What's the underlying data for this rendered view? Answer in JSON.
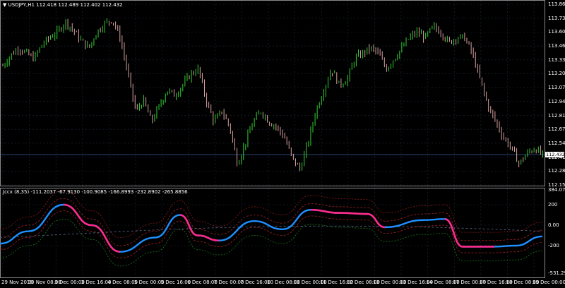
{
  "chart": {
    "symbol_label": "USDJPY,H1",
    "ohlc_text": "112.418 112.489 112.402 112.432",
    "current_price": "112.432",
    "price_ticks": [
      "113.865",
      "113.730",
      "113.600",
      "113.465",
      "113.335",
      "113.205",
      "113.070",
      "112.940",
      "112.810",
      "112.675",
      "112.545",
      "112.410",
      "112.280",
      "112.150"
    ],
    "colors": {
      "bull": "#32cd32",
      "bear": "#d8a0a0",
      "grid": "#1e2a3a",
      "line": "#1e90ff",
      "line_hot": "#ff2a8a"
    }
  },
  "indicator": {
    "label": "Jccx (8,35) -111.2037 -67.9130 -100.9085 -166.8993 -232.8902 -265.8856",
    "ticks": [
      "384.078",
      "200",
      "0.00",
      "-200",
      "-531.2956"
    ]
  },
  "time_axis": [
    "29 Nov 2018",
    "30 Nov 08:00",
    "3 Dec 00:00",
    "3 Dec 16:00",
    "4 Dec 08:00",
    "5 Dec 00:00",
    "5 Dec 16:00",
    "6 Dec 08:00",
    "7 Dec 00:00",
    "7 Dec 16:00",
    "10 Dec 08:00",
    "11 Dec 00:00",
    "11 Dec 16:00",
    "12 Dec 08:00",
    "13 Dec 00:00",
    "13 Dec 16:00",
    "14 Dec 08:00",
    "17 Dec 00:00",
    "17 Dec 16:00",
    "18 Dec 08:00",
    "19 Dec 00:00"
  ],
  "chart_data": {
    "type": "candlestick",
    "title": "USDJPY,H1",
    "ylim": [
      112.15,
      113.865
    ],
    "close_path": [
      113.28,
      113.38,
      113.45,
      113.4,
      113.35,
      113.48,
      113.55,
      113.6,
      113.7,
      113.62,
      113.52,
      113.45,
      113.6,
      113.68,
      113.72,
      113.55,
      113.2,
      112.85,
      112.95,
      112.75,
      112.9,
      113.05,
      113.0,
      113.1,
      113.2,
      113.25,
      112.95,
      112.75,
      112.85,
      112.7,
      112.35,
      112.55,
      112.75,
      112.85,
      112.75,
      112.7,
      112.6,
      112.4,
      112.3,
      112.55,
      112.85,
      113.05,
      113.25,
      113.1,
      113.15,
      113.35,
      113.4,
      113.45,
      113.4,
      113.25,
      113.35,
      113.45,
      113.55,
      113.6,
      113.55,
      113.65,
      113.6,
      113.5,
      113.55,
      113.55,
      113.4,
      113.15,
      112.9,
      112.75,
      112.6,
      112.5,
      112.35,
      112.45,
      112.5,
      112.43
    ]
  }
}
